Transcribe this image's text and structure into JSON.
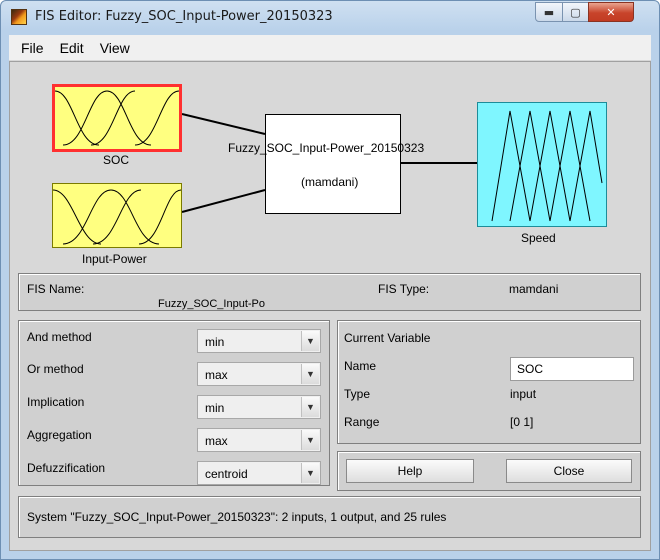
{
  "window": {
    "title": "FIS Editor: Fuzzy_SOC_Input-Power_20150323",
    "minimize_glyph": "▬",
    "maximize_glyph": "▢",
    "close_glyph": "✕"
  },
  "menu": [
    {
      "label": "File"
    },
    {
      "label": "Edit"
    },
    {
      "label": "View"
    }
  ],
  "diagram": {
    "inputs": [
      {
        "name": "SOC",
        "selected": true
      },
      {
        "name": "Input-Power",
        "selected": false
      }
    ],
    "system": {
      "name": "Fuzzy_SOC_Input-Power_20150323",
      "method": "(mamdani)"
    },
    "outputs": [
      {
        "name": "Speed"
      }
    ],
    "colors": {
      "input_fill": "#ffff80",
      "output_fill": "#7ff6ff",
      "selected_border": "#ff3030"
    }
  },
  "fis_info": {
    "name_label": "FIS Name:",
    "name_value": "Fuzzy_SOC_Input-Po",
    "type_label": "FIS Type:",
    "type_value": "mamdani"
  },
  "methods": [
    {
      "label": "And method",
      "value": "min"
    },
    {
      "label": "Or method",
      "value": "max"
    },
    {
      "label": "Implication",
      "value": "min"
    },
    {
      "label": "Aggregation",
      "value": "max"
    },
    {
      "label": "Defuzzification",
      "value": "centroid"
    }
  ],
  "current_variable": {
    "header": "Current Variable",
    "name_label": "Name",
    "name_value": "SOC",
    "type_label": "Type",
    "type_value": "input",
    "range_label": "Range",
    "range_value": "[0 1]"
  },
  "buttons": {
    "help": "Help",
    "close": "Close"
  },
  "status": "System \"Fuzzy_SOC_Input-Power_20150323\": 2 inputs, 1 output, and 25 rules"
}
